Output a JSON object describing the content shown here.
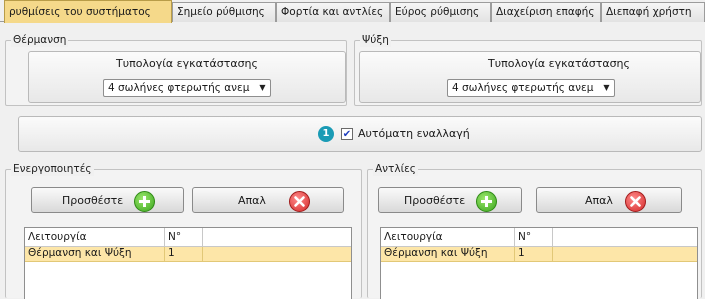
{
  "tabs": [
    {
      "label": "ρυθμίσεις του συστήματος",
      "active": true
    },
    {
      "label": "Σημείο ρύθμισης",
      "active": false
    },
    {
      "label": "Φορτία και αντλίες",
      "active": false
    },
    {
      "label": "Εύρος ρύθμισης",
      "active": false
    },
    {
      "label": "Διαχείριση επαφής",
      "active": false
    },
    {
      "label": "Διεπαφή χρήστη",
      "active": false
    }
  ],
  "heating": {
    "title": "Θέρμανση",
    "typology_label": "Τυπολογία εγκατάστασης",
    "typology_value": "4 σωλήνες φτερωτής ανεμ"
  },
  "cooling": {
    "title": "Ψύξη",
    "typology_label": "Τυπολογία εγκατάστασης",
    "typology_value": "4 σωλήνες φτερωτής ανεμ"
  },
  "auto_switch": {
    "badge": "1",
    "checked": true,
    "check_mark": "✔",
    "label": "Αυτόματη εναλλαγή"
  },
  "actuators": {
    "title": "Ενεργοποιητές",
    "add_label": "Προσθέστε",
    "remove_label": "Απαλ",
    "columns": [
      "Λειτουργία",
      "N°"
    ],
    "rows": [
      [
        "Θέρμανση και Ψύξη",
        "1"
      ]
    ]
  },
  "pumps": {
    "title": "Αντλίες",
    "add_label": "Προσθέστε",
    "remove_label": "Απαλ",
    "columns": [
      "Λειτουργία",
      "N°"
    ],
    "rows": [
      [
        "Θέρμανση και Ψύξη",
        "1"
      ]
    ]
  },
  "icons": {
    "dropdown": "chevron-down-icon",
    "add": "plus-circle-icon",
    "remove": "x-circle-icon"
  },
  "colors": {
    "active_tab": "#f5d98a",
    "selected_row": "#fde6a8",
    "badge": "#1a9bb5",
    "add_icon": "#3ba51e",
    "remove_icon": "#d42a2a"
  }
}
